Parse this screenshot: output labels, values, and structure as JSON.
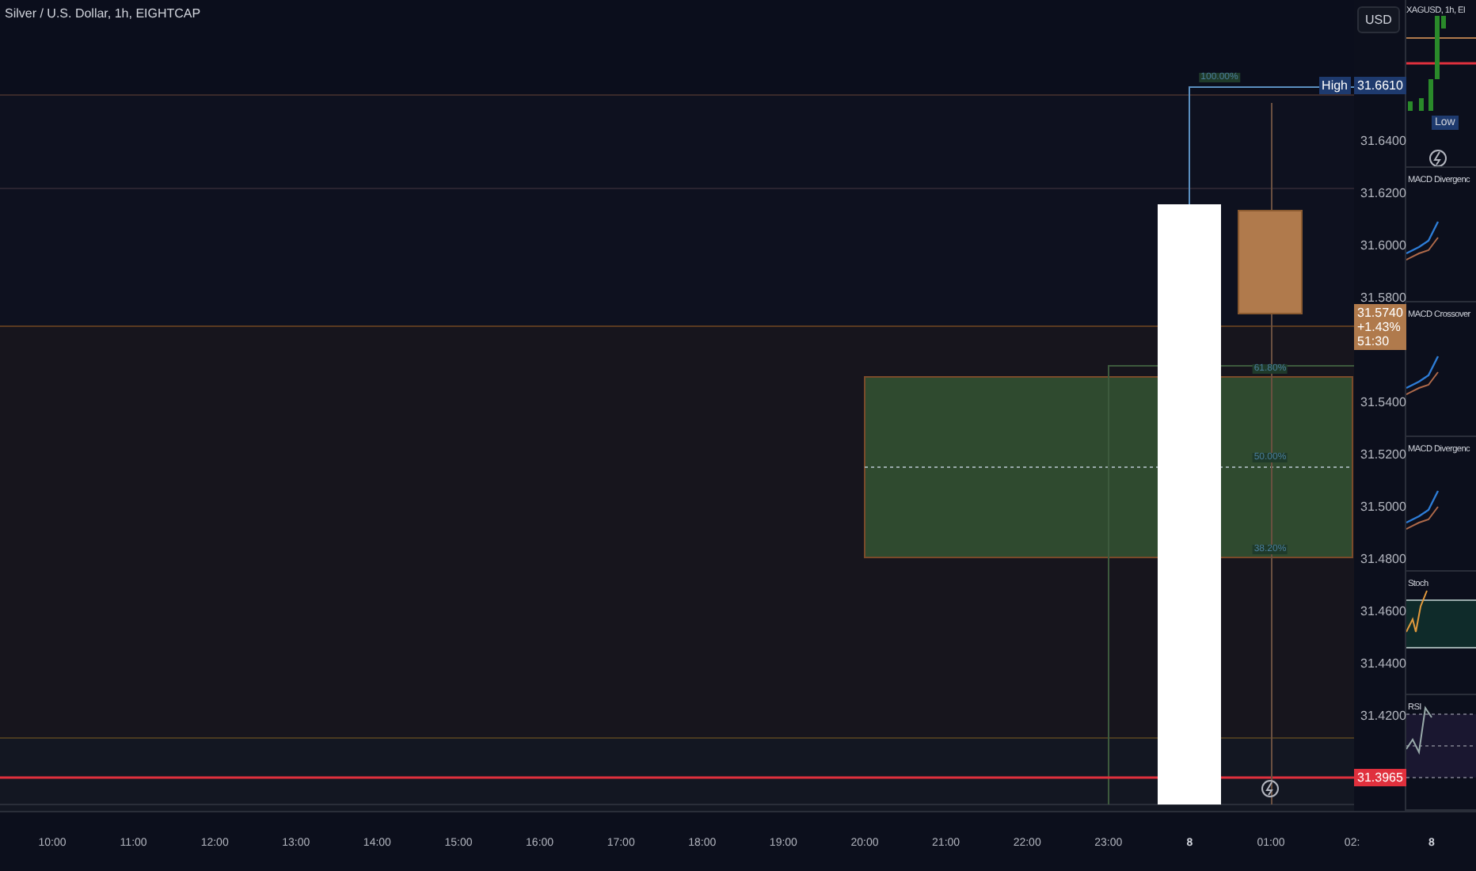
{
  "chart": {
    "title": "Silver / U.S. Dollar, 1h, EIGHTCAP",
    "fib_labels": [
      "100.00%",
      "61.80%",
      "50.00%",
      "38.20%"
    ]
  },
  "price_axis": {
    "currency": "USD",
    "labels": [
      "31.6400",
      "31.6200",
      "31.6000",
      "31.5800",
      "31.5400",
      "31.5200",
      "31.5000",
      "31.4800",
      "31.4600",
      "31.4400",
      "31.4200"
    ],
    "tags": [
      {
        "kind": "high",
        "label": "High",
        "value": "31.6610"
      },
      {
        "kind": "last",
        "value": "31.5740",
        "change": "+1.43%",
        "countdown": "51:30"
      },
      {
        "kind": "alert",
        "value": "31.3965"
      }
    ]
  },
  "time_axis": {
    "labels": [
      "10:00",
      "11:00",
      "12:00",
      "13:00",
      "14:00",
      "15:00",
      "16:00",
      "17:00",
      "18:00",
      "19:00",
      "20:00",
      "21:00",
      "22:00",
      "23:00",
      "8",
      "01:00",
      "02:"
    ]
  },
  "side_panel": {
    "title": "XAGUSD, 1h, EI",
    "low_tag": "Low",
    "panes": [
      {
        "name": "MACD Divergenc",
        "kind": "macd"
      },
      {
        "name": "MACD Crossover",
        "kind": "macd"
      },
      {
        "name": "MACD Divergenc",
        "kind": "macd"
      },
      {
        "name": "Stoch",
        "kind": "stoch"
      },
      {
        "name": "RSI",
        "kind": "rsi"
      }
    ],
    "time_label": "8"
  }
}
